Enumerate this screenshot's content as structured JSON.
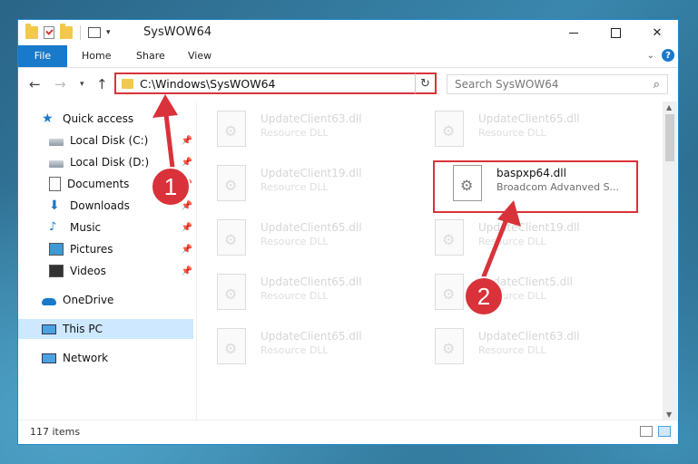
{
  "window": {
    "title": "SysWOW64",
    "minimize_icon": "minimize-icon",
    "maximize_icon": "maximize-icon",
    "close_glyph": "✕"
  },
  "ribbon": {
    "tabs": [
      "File",
      "Home",
      "Share",
      "View"
    ],
    "help_label": "?"
  },
  "nav": {
    "back": "←",
    "forward": "→",
    "up": "↑",
    "address": "C:\\Windows\\SysWOW64",
    "refresh": "↻",
    "search_placeholder": "Search SysWOW64"
  },
  "sidebar": {
    "items": [
      {
        "label": "Quick access",
        "icon": "star-icon"
      },
      {
        "label": "Local Disk (C:)",
        "icon": "drive-icon"
      },
      {
        "label": "Local Disk (D:)",
        "icon": "drive-icon"
      },
      {
        "label": "Documents",
        "icon": "documents-icon"
      },
      {
        "label": "Downloads",
        "icon": "downloads-icon"
      },
      {
        "label": "Music",
        "icon": "music-icon"
      },
      {
        "label": "Pictures",
        "icon": "pictures-icon"
      },
      {
        "label": "Videos",
        "icon": "videos-icon"
      },
      {
        "label": "OneDrive",
        "icon": "onedrive-icon"
      },
      {
        "label": "This PC",
        "icon": "computer-icon"
      },
      {
        "label": "Network",
        "icon": "network-icon"
      }
    ]
  },
  "files": [
    {
      "name": "UpdateClient63.dll",
      "desc": "Resource DLL"
    },
    {
      "name": "UpdateClient65.dll",
      "desc": "Resource DLL"
    },
    {
      "name": "UpdateClient19.dll",
      "desc": "Resource DLL"
    },
    {
      "name": "baspxp64.dll",
      "desc": "Broadcom Advanved S..."
    },
    {
      "name": "UpdateClient65.dll",
      "desc": "Resource DLL"
    },
    {
      "name": "UpdateClient19.dll",
      "desc": "Resource DLL"
    },
    {
      "name": "UpdateClient65.dll",
      "desc": "Resource DLL"
    },
    {
      "name": "UpdateClient5.dll",
      "desc": "Resource DLL"
    },
    {
      "name": "UpdateClient65.dll",
      "desc": "Resource DLL"
    },
    {
      "name": "UpdateClient63.dll",
      "desc": "Resource DLL"
    }
  ],
  "status": {
    "item_count": "117 items"
  },
  "annotations": {
    "step1": "1",
    "step2": "2",
    "color": "#d9323a"
  }
}
